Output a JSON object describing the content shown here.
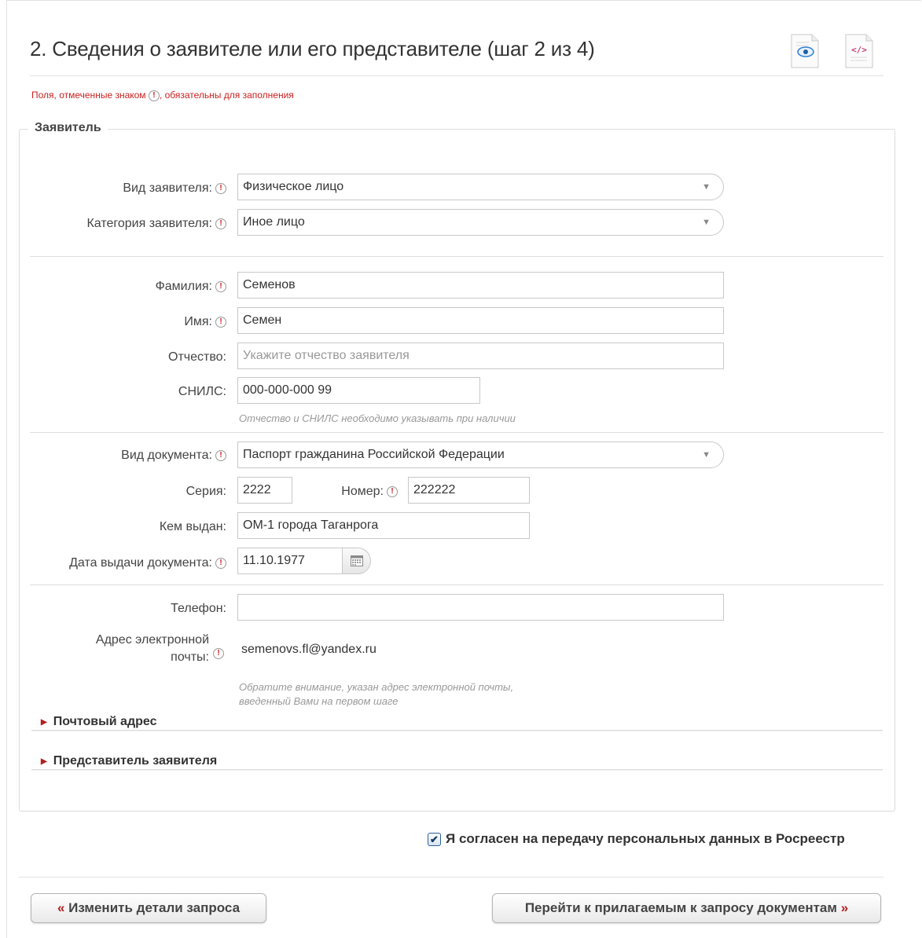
{
  "page": {
    "title": "2. Сведения о заявителе или его представителе (шаг 2 из 4)",
    "required_note_prefix": "Поля, отмеченные знаком",
    "required_note_suffix": ", обязательны для заполнения",
    "required_mark": "!"
  },
  "applicant": {
    "legend": "Заявитель",
    "applicant_type": {
      "label": "Вид заявителя:",
      "value": "Физическое лицо"
    },
    "applicant_category": {
      "label": "Категория заявителя:",
      "value": "Иное лицо"
    },
    "last_name": {
      "label": "Фамилия:",
      "value": "Семенов"
    },
    "first_name": {
      "label": "Имя:",
      "value": "Семен"
    },
    "patronymic": {
      "label": "Отчество:",
      "placeholder": "Укажите отчество заявителя"
    },
    "snils": {
      "label": "СНИЛС:",
      "value": "000-000-000 99"
    },
    "snils_hint": "Отчество и СНИЛС необходимо указывать при наличии",
    "document_type": {
      "label": "Вид документа:",
      "value": "Паспорт гражданина Российской Федерации"
    },
    "series": {
      "label": "Серия:",
      "value": "2222"
    },
    "number": {
      "label": "Номер:",
      "value": "222222"
    },
    "issued_by": {
      "label": "Кем выдан:",
      "value": "ОМ-1 города Таганрога"
    },
    "issue_date": {
      "label": "Дата выдачи документа:",
      "value": "11.10.1977"
    },
    "phone": {
      "label": "Телефон:",
      "value": ""
    },
    "email": {
      "label_line1": "Адрес электронной",
      "label_line2": "почты:",
      "value": "semenovs.fl@yandex.ru",
      "hint_line1": "Обратите внимание, указан адрес электронной почты,",
      "hint_line2": "введенный Вами на первом шаге"
    },
    "postal_address": "Почтовый адрес",
    "representative": "Представитель заявителя"
  },
  "consent": {
    "label": "Я согласен на передачу персональных данных в Росреестр",
    "checked": true
  },
  "buttons": {
    "back": "Изменить детали запроса",
    "back_chevron": "«",
    "next": "Перейти к прилагаемым к запросу документам",
    "next_chevron": "»"
  },
  "icons": {
    "preview": "eye-document-icon",
    "xml": "xml-code-document-icon",
    "calendar": "calendar-icon",
    "dropdown": "chevron-down-icon",
    "expand": "triangle-right-icon",
    "check": "checkmark-icon"
  },
  "colors": {
    "required": "#cc1f1f",
    "accent_arrow": "#b32020",
    "border": "#c8c8c8"
  }
}
